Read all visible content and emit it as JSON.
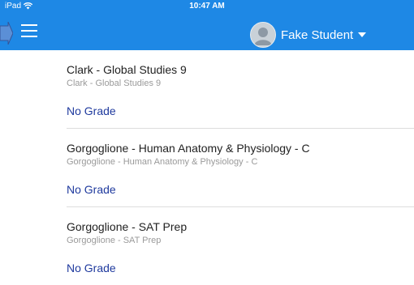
{
  "status": {
    "carrier": "iPad",
    "time": "10:47 AM"
  },
  "header": {
    "user_name": "Fake Student"
  },
  "courses": [
    {
      "title": "Clark - Global Studies 9",
      "subtitle": "Clark - Global Studies 9",
      "grade": "No Grade"
    },
    {
      "title": "Gorgoglione - Human Anatomy & Physiology - C",
      "subtitle": "Gorgoglione - Human Anatomy & Physiology - C",
      "grade": "No Grade"
    },
    {
      "title": "Gorgoglione - SAT Prep",
      "subtitle": "Gorgoglione - SAT Prep",
      "grade": "No Grade"
    }
  ],
  "colors": {
    "header": "#1e88e5",
    "grade_link": "#1f3a9e",
    "pointer": "#5b8fd6"
  },
  "icons": [
    "wifi-icon",
    "menu-icon",
    "pointer-arrow-icon",
    "avatar-icon",
    "caret-down-icon"
  ]
}
